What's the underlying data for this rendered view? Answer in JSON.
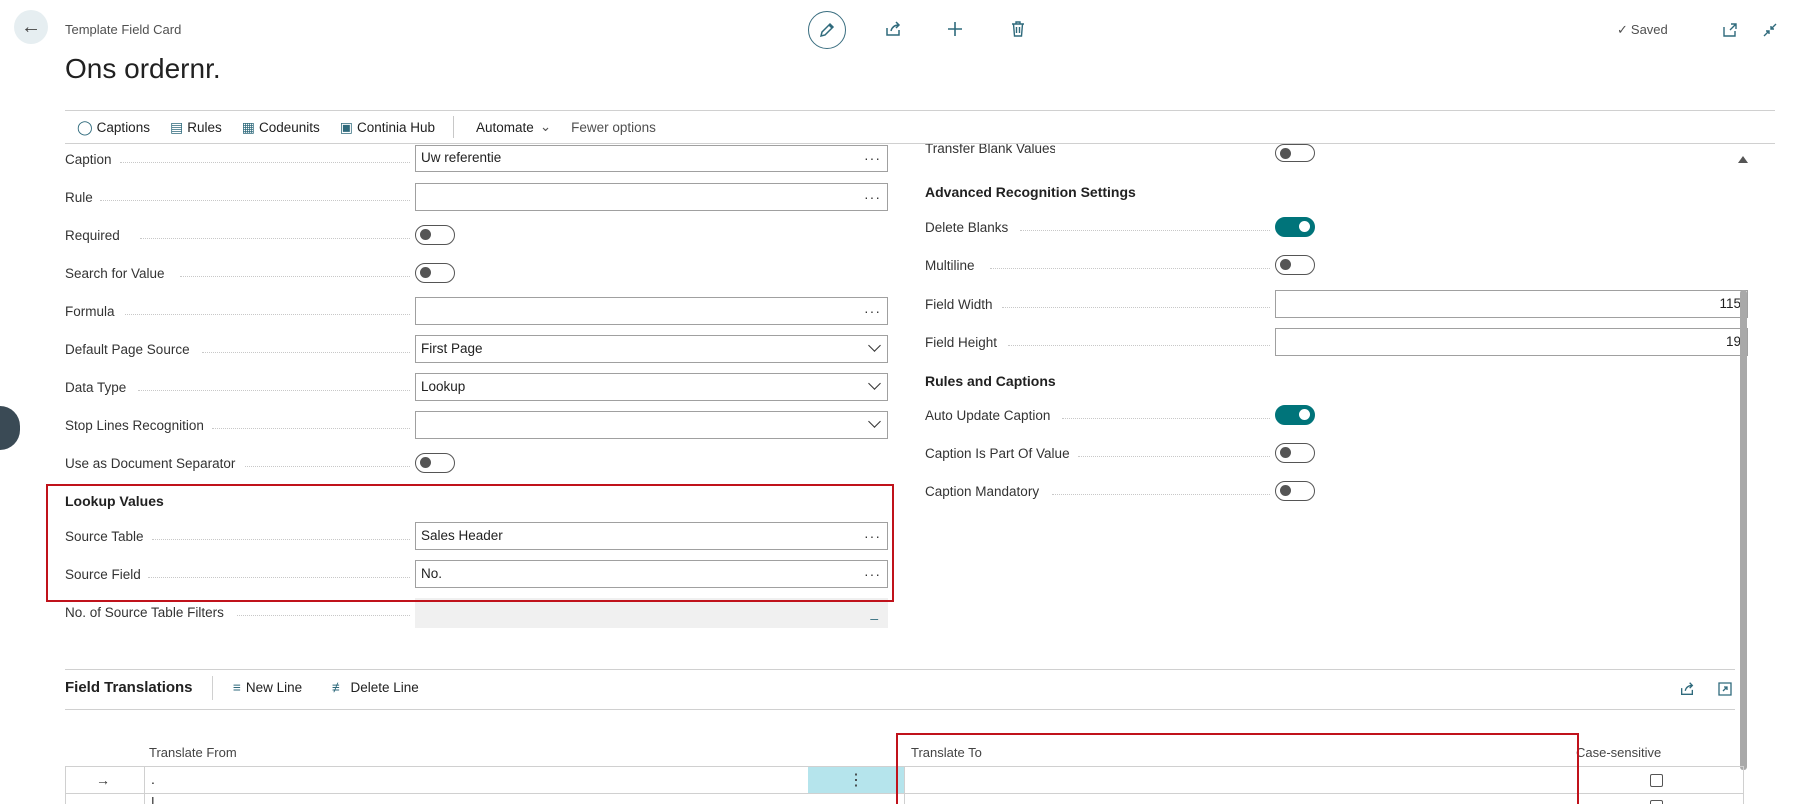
{
  "header": {
    "breadcrumb": "Template Field Card",
    "title": "Ons ordernr.",
    "saved_label": "Saved"
  },
  "actions": {
    "captions": "Captions",
    "rules": "Rules",
    "codeunits": "Codeunits",
    "continia_hub": "Continia Hub",
    "automate": "Automate",
    "fewer_options": "Fewer options"
  },
  "left_fields": {
    "caption": {
      "label": "Caption",
      "value": "Uw referentie"
    },
    "rule": {
      "label": "Rule",
      "value": ""
    },
    "required": {
      "label": "Required",
      "on": false
    },
    "search_for_value": {
      "label": "Search for Value",
      "on": false
    },
    "formula": {
      "label": "Formula",
      "value": ""
    },
    "default_page_source": {
      "label": "Default Page Source",
      "value": "First Page"
    },
    "data_type": {
      "label": "Data Type",
      "value": "Lookup"
    },
    "stop_lines_recognition": {
      "label": "Stop Lines Recognition",
      "value": ""
    },
    "use_as_document_separator": {
      "label": "Use as Document Separator",
      "on": false
    }
  },
  "lookup_values": {
    "heading": "Lookup Values",
    "source_table": {
      "label": "Source Table",
      "value": "Sales Header"
    },
    "source_field": {
      "label": "Source Field",
      "value": "No."
    },
    "source_table_filters": {
      "label": "No. of Source Table Filters",
      "value": "_"
    }
  },
  "right_fields": {
    "transfer_blank_values": {
      "label": "Transfer Blank Values",
      "on": false
    },
    "advanced_heading": "Advanced Recognition Settings",
    "delete_blanks": {
      "label": "Delete Blanks",
      "on": true
    },
    "multiline": {
      "label": "Multiline",
      "on": false
    },
    "field_width": {
      "label": "Field Width",
      "value": "115"
    },
    "field_height": {
      "label": "Field Height",
      "value": "19"
    },
    "rules_captions_heading": "Rules and Captions",
    "auto_update_caption": {
      "label": "Auto Update Caption",
      "on": true
    },
    "caption_is_part_of_value": {
      "label": "Caption Is Part Of Value",
      "on": false
    },
    "caption_mandatory": {
      "label": "Caption Mandatory",
      "on": false
    }
  },
  "translations": {
    "heading": "Field Translations",
    "new_line": "New Line",
    "delete_line": "Delete Line",
    "columns": [
      "Translate From",
      "Translate To",
      "Case-sensitive"
    ],
    "rows": [
      {
        "from": ".",
        "to": "",
        "case_sensitive": false
      },
      {
        "from": "|",
        "to": "",
        "case_sensitive": false
      }
    ]
  },
  "colors": {
    "accent": "#00747a",
    "icon": "#2f6a7c",
    "highlight_border": "#c0121b",
    "selected_cell": "#b5e4ec"
  }
}
